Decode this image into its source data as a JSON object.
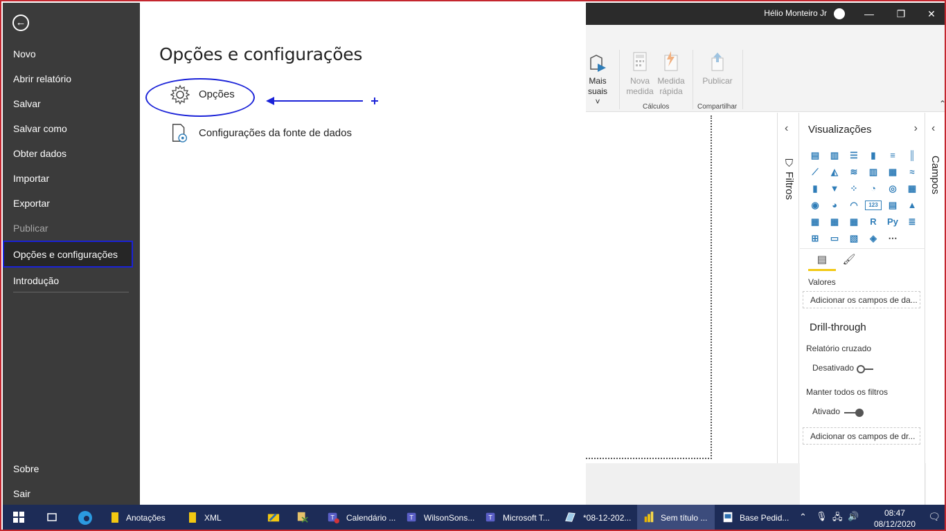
{
  "titlebar": {
    "user": "Hélio Monteiro Jr",
    "minimize": "—",
    "restore": "❐",
    "close": "✕"
  },
  "ribbon": {
    "buttons": [
      {
        "label": "Mais\nvisuais ˅",
        "text1": "Mais",
        "text2": "suais ˅"
      },
      {
        "text1": "Nova",
        "text2": "medida"
      },
      {
        "text1": "Medida",
        "text2": "rápida"
      },
      {
        "text1": "Publicar",
        "text2": ""
      }
    ],
    "groups": {
      "calculos": "Cálculos",
      "compartilhar": "Compartilhar"
    }
  },
  "filters": {
    "label": "Filtros"
  },
  "visualizations": {
    "title": "Visualizações",
    "icons": [
      "stacked-bar-icon",
      "stacked-column-icon",
      "clustered-bar-icon",
      "clustered-column-icon",
      "100-bar-icon",
      "100-column-icon",
      "line-icon",
      "area-icon",
      "stacked-area-icon",
      "line-column-icon",
      "line-clustered-icon",
      "ribbon-icon",
      "waterfall-icon",
      "funnel-icon",
      "scatter-icon",
      "pie-icon",
      "donut-icon",
      "treemap-icon",
      "map-icon",
      "filled-map-icon",
      "gauge-icon",
      "card-icon",
      "multi-row-card-icon",
      "kpi-icon",
      "slicer-icon",
      "table-icon",
      "matrix-icon",
      "r-visual-icon",
      "python-visual-icon",
      "key-influencers-icon",
      "decomposition-tree-icon",
      "qa-icon",
      "smart-narrative-icon",
      "arcgis-icon",
      "more-icon"
    ],
    "valores": "Valores",
    "valores_placeholder": "Adicionar os campos de da...",
    "drill_title": "Drill-through",
    "cross_report": "Relatório cruzado",
    "cross_report_state": "Desativado",
    "keep_filters": "Manter todos os filtros",
    "keep_filters_state": "Ativado",
    "drill_placeholder": "Adicionar os campos de dr..."
  },
  "fields": {
    "label": "Campos"
  },
  "backstage": {
    "menu": [
      {
        "label": "Novo",
        "disabled": false
      },
      {
        "label": "Abrir relatório",
        "disabled": false
      },
      {
        "label": "Salvar",
        "disabled": false
      },
      {
        "label": "Salvar como",
        "disabled": false
      },
      {
        "label": "Obter dados",
        "disabled": false
      },
      {
        "label": "Importar",
        "disabled": false
      },
      {
        "label": "Exportar",
        "disabled": false
      },
      {
        "label": "Publicar",
        "disabled": true
      }
    ],
    "selected": "Opções e configurações",
    "intro": "Introdução",
    "about": "Sobre",
    "exit": "Sair"
  },
  "main": {
    "title": "Opções e configurações",
    "options": [
      {
        "label": "Opções"
      },
      {
        "label": "Configurações da fonte de dados"
      }
    ]
  },
  "taskbar": {
    "items": [
      {
        "label": "Anotações"
      },
      {
        "label": "XML"
      },
      {
        "label": "Calendário ..."
      },
      {
        "label": "WilsonSons..."
      },
      {
        "label": "Microsoft T..."
      },
      {
        "label": "*08-12-202..."
      },
      {
        "label": "Sem título ..."
      },
      {
        "label": "Base Pedid..."
      }
    ],
    "time": "08:47",
    "date": "08/12/2020"
  },
  "colors": {
    "accent_yellow": "#f2c811",
    "annotation_blue": "#1a22d8",
    "backstage_bg": "#3b3b3b",
    "taskbar_bg": "#1d2c57",
    "window_border": "#c4262e"
  }
}
